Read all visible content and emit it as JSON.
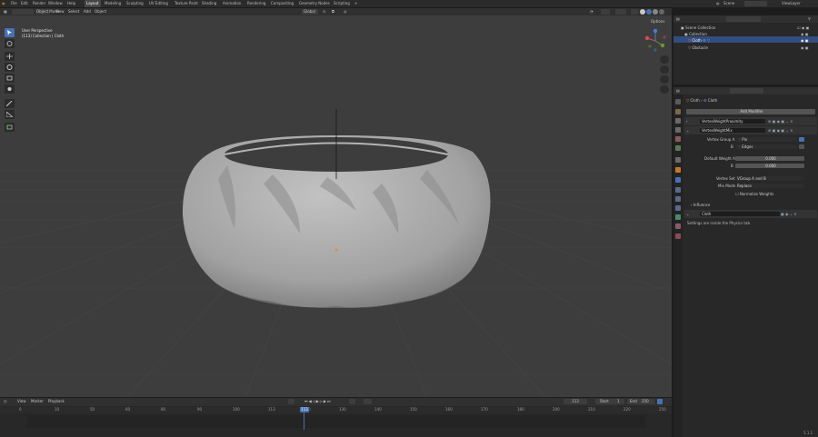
{
  "menu": {
    "items": [
      "File",
      "Edit",
      "Render",
      "Window",
      "Help"
    ],
    "workspaces": [
      "Layout",
      "Modeling",
      "Sculpting",
      "UV Editing",
      "Texture Paint",
      "Shading",
      "Animation",
      "Rendering",
      "Compositing",
      "Geometry Nodes",
      "Scripting"
    ],
    "active_workspace": "Layout",
    "add_tab": "+",
    "scene_label": "Scene",
    "viewlayer_label": "ViewLayer"
  },
  "viewport_header": {
    "mode": "Object Mode",
    "view": "View",
    "select": "Select",
    "add": "Add",
    "object": "Object",
    "transform": "Global",
    "options": "Options"
  },
  "viewport": {
    "perspective": "User Perspective",
    "collection_line": "(113) Collection | Cloth"
  },
  "outliner": {
    "search_placeholder": "",
    "rows": [
      {
        "label": "Scene Collection"
      },
      {
        "label": "Collection"
      },
      {
        "label": "Cloth"
      },
      {
        "label": "Obstacle"
      }
    ]
  },
  "properties": {
    "breadcrumb_object": "Cloth",
    "breadcrumb_modifiers": "Cloth",
    "add_modifier": "Add Modifier",
    "modifiers": [
      {
        "name": "VertexWeightProximity"
      },
      {
        "name": "VertexWeightMix"
      }
    ],
    "vertex_group_a_label": "Vertex Group A",
    "vertex_group_a_value": "Pin",
    "vertex_group_b_label": "B",
    "vertex_group_b_value": "Edges",
    "default_weight_a_label": "Default Weight A",
    "default_weight_a_value": "0.000",
    "default_weight_b_label": "B",
    "default_weight_b_value": "0.000",
    "vertex_set_label": "Vertex Set",
    "vertex_set_value": "VGroup A and B",
    "mix_mode_label": "Mix Mode",
    "mix_mode_value": "Replace",
    "normalize_label": "Normalize Weights",
    "influence_label": "Influence",
    "cloth_modifier_name": "Cloth",
    "cloth_note": "Settings are inside the Physics tab"
  },
  "timeline": {
    "menu": [
      "View",
      "Marker",
      "Playback"
    ],
    "current_frame": "113",
    "start_label": "Start",
    "start_value": "1",
    "end_label": "End",
    "end_value": "250",
    "ticks": [
      "0",
      "10",
      "50",
      "60",
      "80",
      "90",
      "100",
      "113",
      "120",
      "130",
      "140",
      "150",
      "160",
      "170",
      "180",
      "200",
      "210",
      "220",
      "250"
    ],
    "playhead_label": "113"
  },
  "status": {
    "version": "5.1.1"
  },
  "colors": {
    "accent": "#4772b3",
    "playhead": "#4772b3",
    "active_row": "#334d80"
  }
}
